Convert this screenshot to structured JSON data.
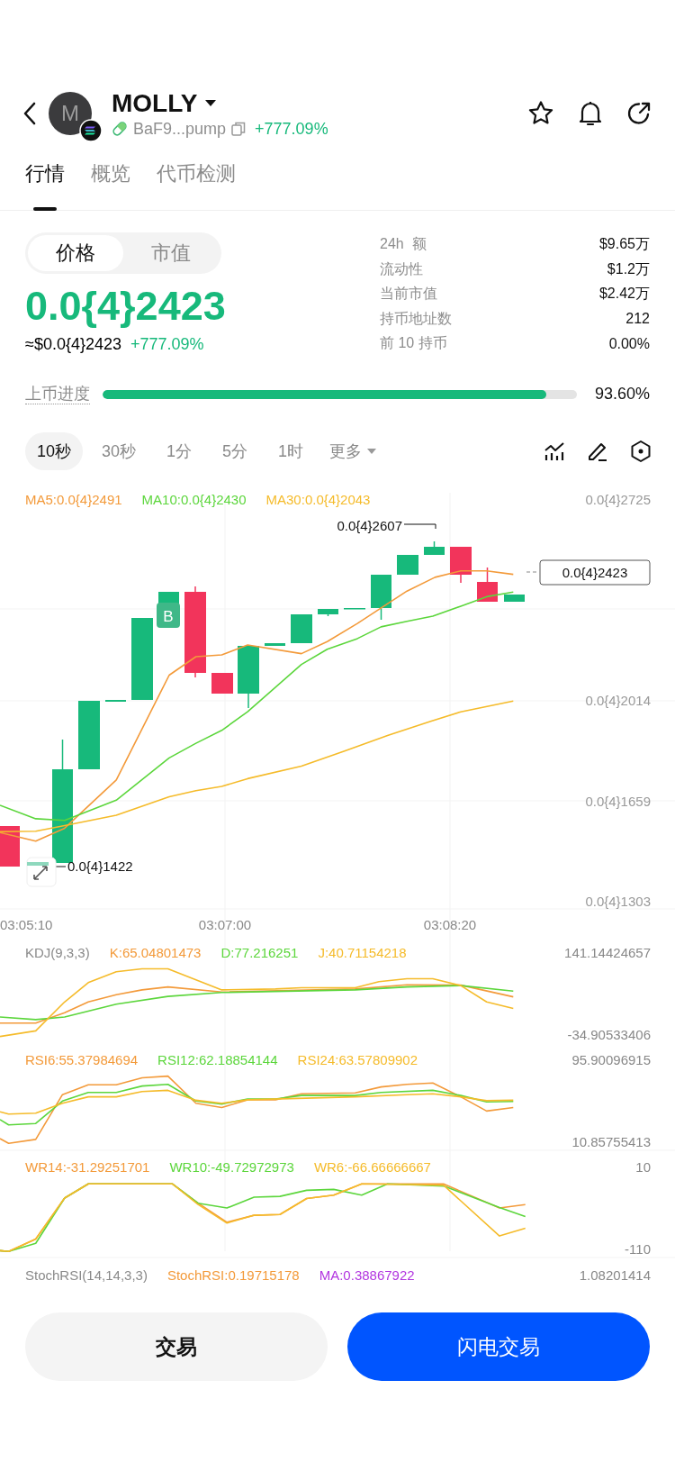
{
  "header": {
    "avatar_letter": "M",
    "title": "MOLLY",
    "address": "BaF9...pump",
    "change": "+777.09%"
  },
  "tabs": [
    {
      "label": "行情",
      "selected": true
    },
    {
      "label": "概览",
      "selected": false
    },
    {
      "label": "代币检测",
      "selected": false
    }
  ],
  "price_toggle": [
    {
      "label": "价格",
      "selected": true
    },
    {
      "label": "市值",
      "selected": false
    }
  ],
  "price": "0.0{4}2423",
  "usd_price": "≈$0.0{4}2423",
  "usd_change": "+777.09%",
  "stats": [
    {
      "label": "24h  额",
      "value": "$9.65万"
    },
    {
      "label": "流动性",
      "value": "$1.2万"
    },
    {
      "label": "当前市值",
      "value": "$2.42万"
    },
    {
      "label": "持币地址数",
      "value": "212"
    },
    {
      "label": "前 10 持币",
      "value": "0.00%"
    }
  ],
  "progress": {
    "label": "上币进度",
    "level": 0.936,
    "reading": "93.60%"
  },
  "timeframes": [
    {
      "label": "10秒",
      "selected": true
    },
    {
      "label": "30秒",
      "selected": false
    },
    {
      "label": "1分",
      "selected": false
    },
    {
      "label": "5分",
      "selected": false
    },
    {
      "label": "1时",
      "selected": false
    }
  ],
  "more_menu": {
    "label": "更多"
  },
  "chart": {
    "legend": [
      {
        "text": "MA5:0.0{4}2491",
        "color": "#f39a3a"
      },
      {
        "text": "MA10:0.0{4}2430",
        "color": "#5cd63c"
      },
      {
        "text": "MA30:0.0{4}2043",
        "color": "#f5bb2a"
      }
    ],
    "y_labels": [
      "0.0{4}2725",
      "0.0{4}2014",
      "0.0{4}1659",
      "0.0{4}1303"
    ],
    "high_marker": "0.0{4}2607",
    "low_marker": "0.0{4}1422",
    "current_price": "0.0{4}2423",
    "buy_marker": "B",
    "time_labels": [
      "03:05:10",
      "03:07:00",
      "03:08:20"
    ]
  },
  "indicators": [
    {
      "title": "KDJ(9,3,3)",
      "values": [
        {
          "text": "K:65.04801473",
          "color": "#f39a3a"
        },
        {
          "text": "D:77.216251",
          "color": "#5cd63c"
        },
        {
          "text": "J:40.71154218",
          "color": "#f5bb2a"
        }
      ],
      "max": "141.14424657",
      "min": "-34.90533406"
    },
    {
      "values": [
        {
          "text": "RSI6:55.37984694",
          "color": "#f39a3a"
        },
        {
          "text": "RSI12:62.18854144",
          "color": "#5cd63c"
        },
        {
          "text": "RSI24:63.57809902",
          "color": "#f5bb2a"
        }
      ],
      "max": "95.90096915",
      "min": "10.85755413"
    },
    {
      "values": [
        {
          "text": "WR14:-31.29251701",
          "color": "#f39a3a"
        },
        {
          "text": "WR10:-49.72972973",
          "color": "#5cd63c"
        },
        {
          "text": "WR6:-66.66666667",
          "color": "#f5bb2a"
        }
      ],
      "max": "10",
      "min": "-110"
    },
    {
      "title": "StochRSI(14,14,3,3)",
      "values": [
        {
          "text": "StochRSI:0.19715178",
          "color": "#f39a3a"
        },
        {
          "text": "MA:0.38867922",
          "color": "#b236e0"
        }
      ],
      "max": "1.08201414"
    }
  ],
  "buttons": [
    {
      "label": "交易",
      "kind": "secondary"
    },
    {
      "label": "闪电交易",
      "kind": "primary"
    }
  ]
}
